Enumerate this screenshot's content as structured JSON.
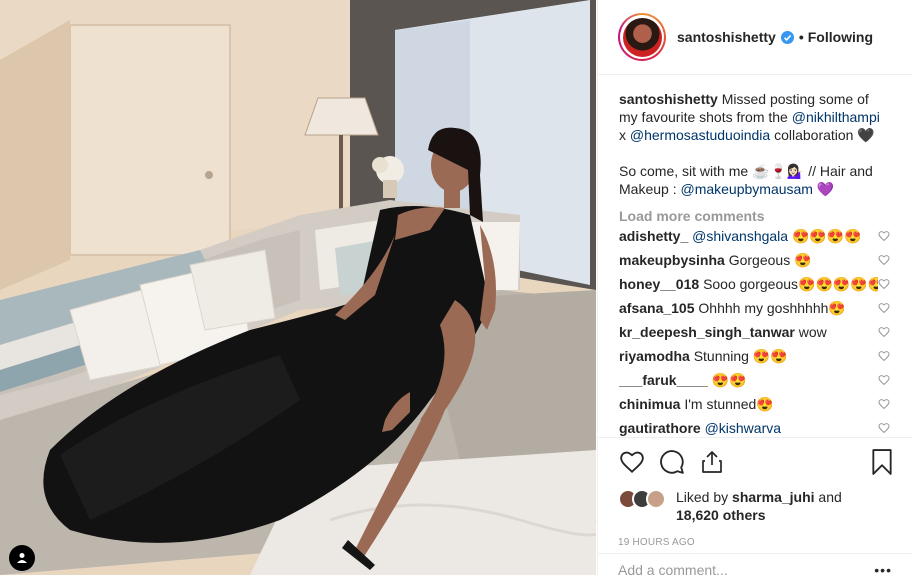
{
  "post": {
    "username": "santoshishetty",
    "separator": "•",
    "follow_status": "Following",
    "caption": {
      "username": "santoshishetty",
      "line1_pre": "Missed posting some of my favourite shots from the ",
      "mention1": "@nikhilthampi",
      "line1_mid": " x ",
      "mention2": "@hermosastuduoindia",
      "line1_post": " collaboration 🖤",
      "line2_pre": "So come, sit with me ☕️🍷💁🏻‍♀️ // Hair and Makeup : ",
      "mention3": "@makeupbymausam",
      "line2_post": " 💜"
    },
    "load_more": "Load more comments",
    "comments": [
      {
        "user": "adishetty_",
        "mention": "@shivanshgala",
        "text": " 😍😍😍😍"
      },
      {
        "user": "makeupbysinha",
        "mention": "",
        "text": "Gorgeous 😍"
      },
      {
        "user": "honey__018",
        "mention": "",
        "text": "Sooo gorgeous😍😍😍😍😍😍"
      },
      {
        "user": "afsana_105",
        "mention": "",
        "text": "Ohhhh my goshhhhh😍"
      },
      {
        "user": "kr_deepesh_singh_tanwar",
        "mention": "",
        "text": "wow"
      },
      {
        "user": "riyamodha",
        "mention": "",
        "text": "Stunning 😍😍"
      },
      {
        "user": "___faruk____",
        "mention": "",
        "text": "😍😍"
      },
      {
        "user": "chinimua",
        "mention": "",
        "text": "I'm stunned😍"
      },
      {
        "user": "gautirathore",
        "mention": "@kishwarva",
        "text": ""
      }
    ],
    "liked_by_prefix": "Liked by ",
    "liked_by_user": "sharma_juhi",
    "liked_by_and": " and",
    "likes_count": "18,620 others",
    "timestamp": "19 HOURS AGO",
    "comment_placeholder": "Add a comment...",
    "more_label": "•••"
  },
  "icons": {
    "like": "heart-icon",
    "comment": "comment-bubble-icon",
    "share": "share-icon",
    "save": "bookmark-icon",
    "verified": "verified-badge-icon",
    "tag": "user-tag-icon"
  },
  "colors": {
    "mention": "#003569",
    "muted": "#999999",
    "verified": "#3897f0",
    "text": "#262626"
  }
}
